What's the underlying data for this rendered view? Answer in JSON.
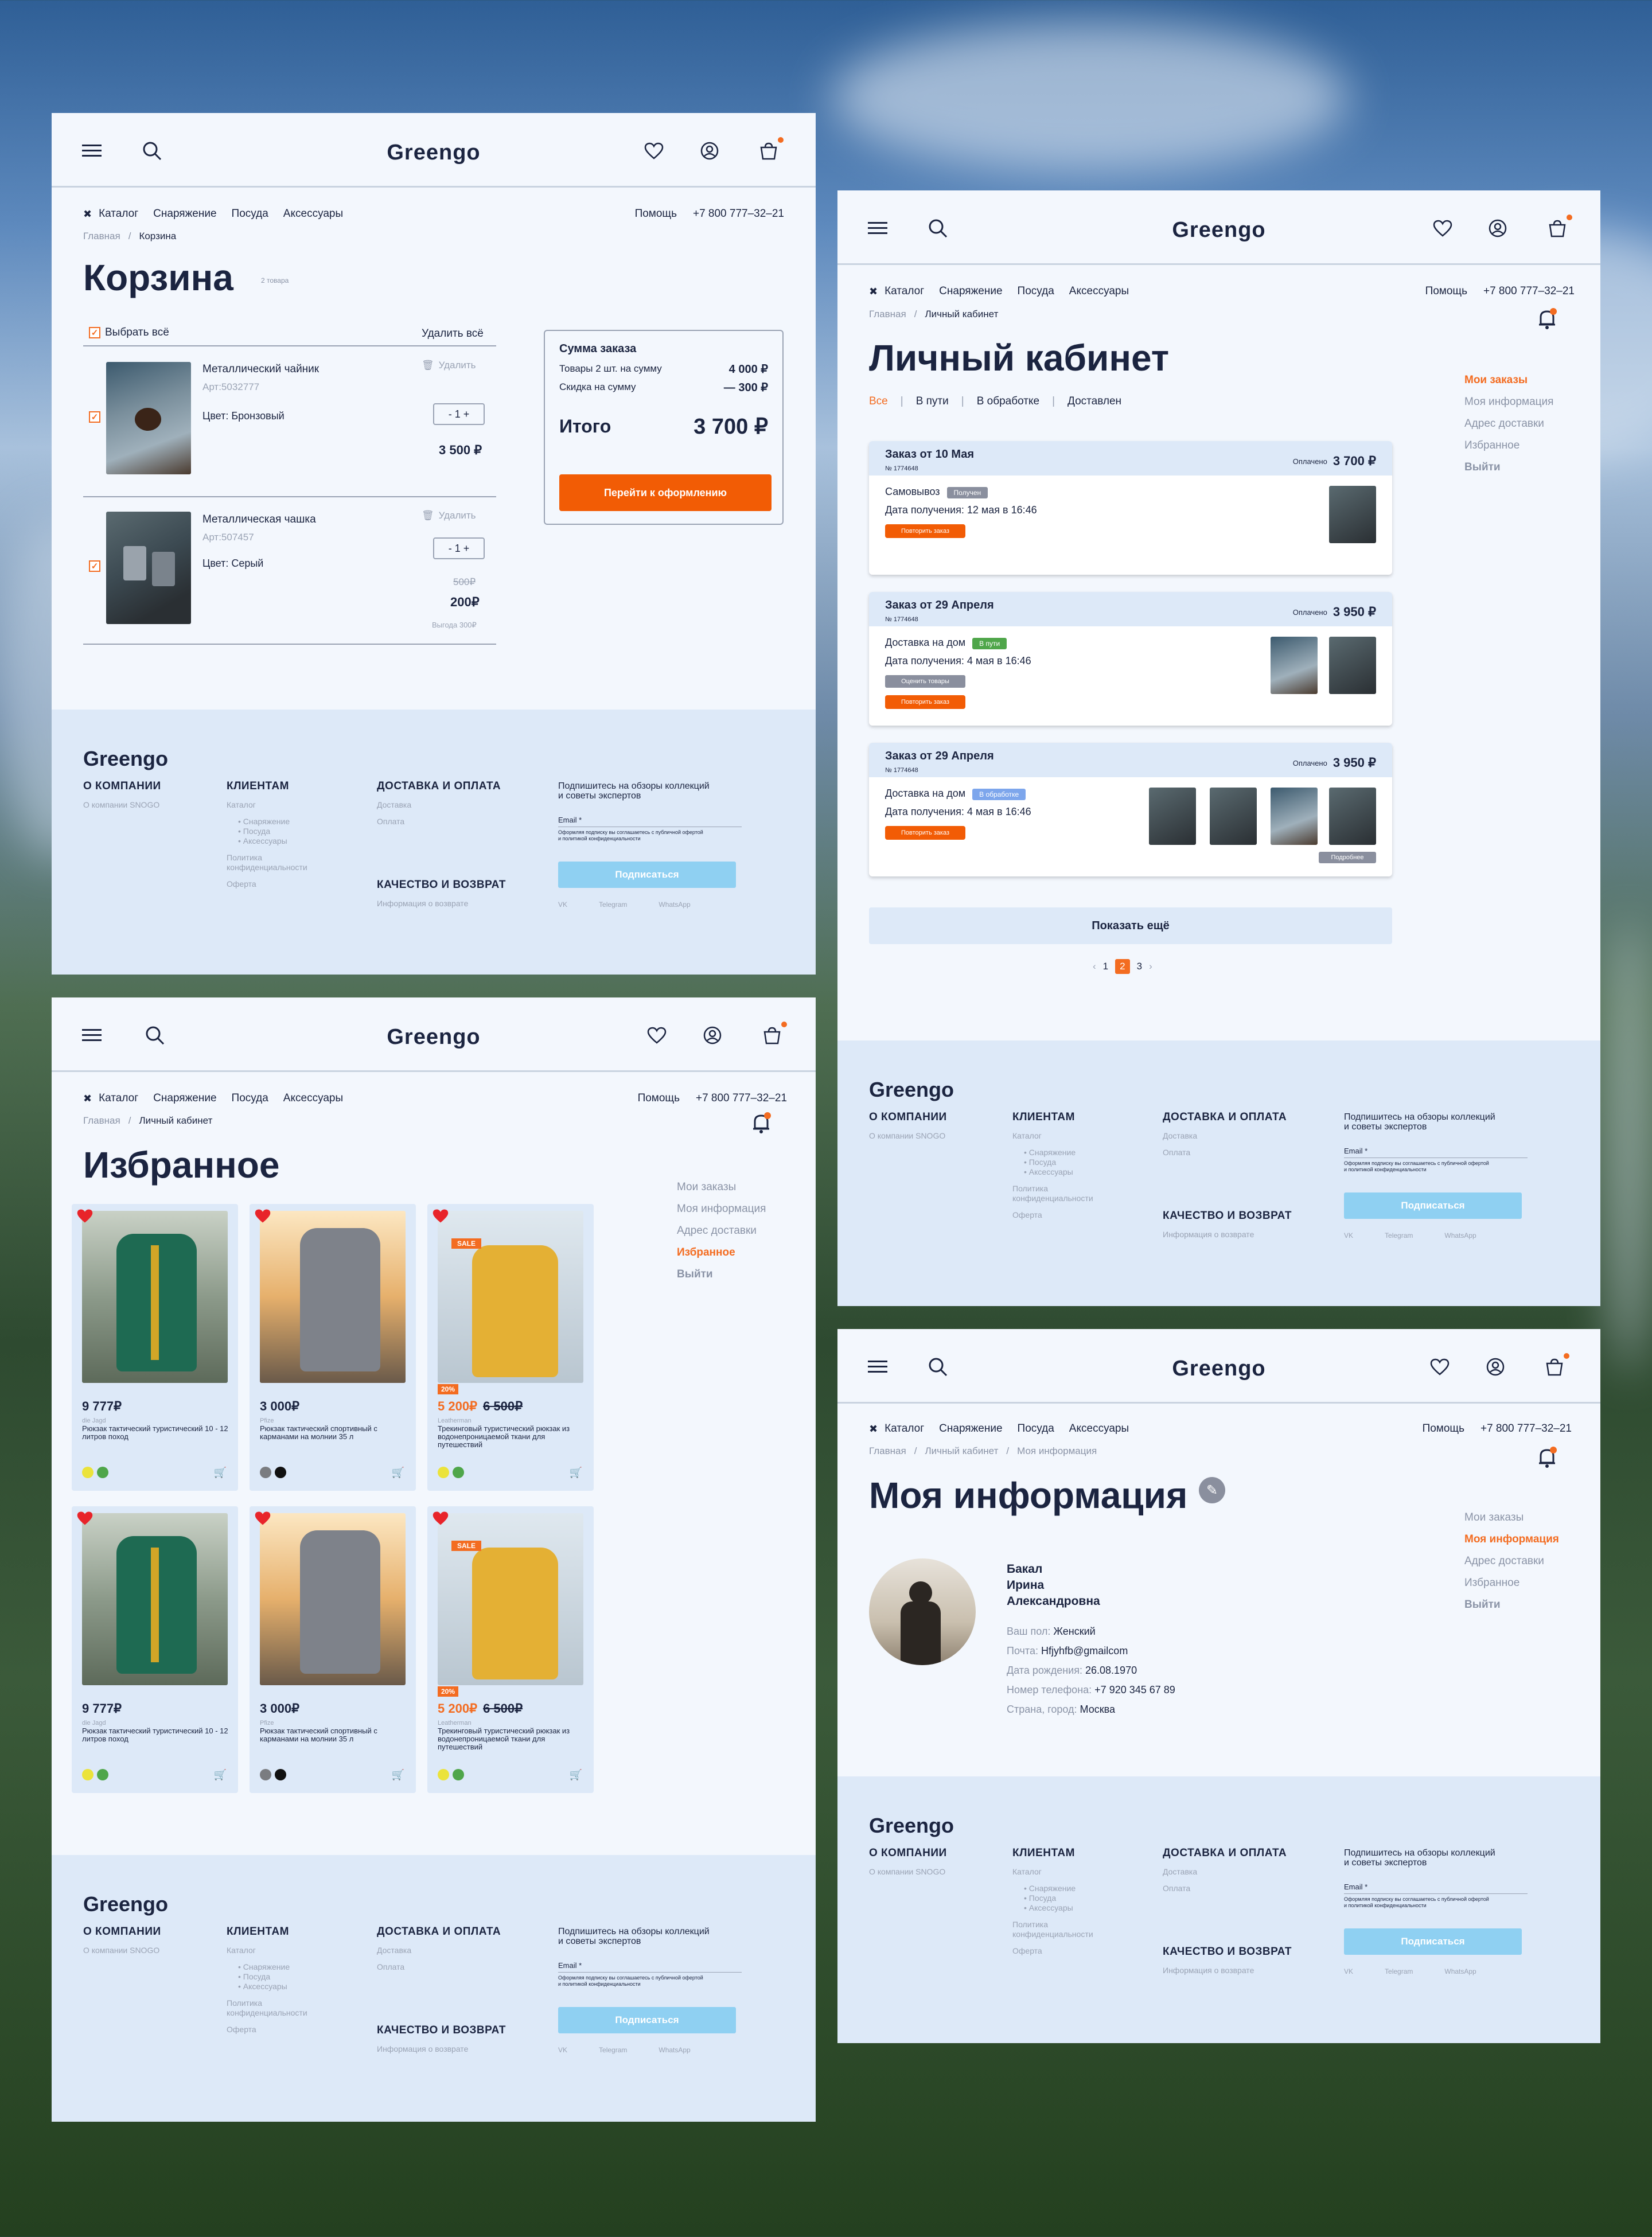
{
  "brand": "Greengo",
  "nav": {
    "catalog": "Каталог",
    "equipment": "Снаряжение",
    "dishes": "Посуда",
    "accessories": "Аксессуары",
    "help": "Помощь",
    "phone": "+7 800 777–32–21"
  },
  "crumbs": {
    "home": "Главная",
    "sep": "/",
    "cart": "Корзина",
    "account": "Личный кабинет",
    "myinfo": "Моя информация"
  },
  "cart": {
    "title": "Корзина",
    "count": "2 товара",
    "select_all": "Выбрать всё",
    "delete_all": "Удалить всё",
    "delete": "Удалить",
    "items": [
      {
        "name": "Металлический чайник",
        "art": "Арт:5032777",
        "color": "Цвет: Бронзовый",
        "qty": "- 1 +",
        "price": "3 500 ₽"
      },
      {
        "name": "Металлическая чашка",
        "art": "Арт:507457",
        "color": "Цвет: Серый",
        "qty": "- 1 +",
        "old": "500₽",
        "price": "200₽",
        "saving": "Выгода 300₽"
      }
    ],
    "summary": {
      "title": "Сумма заказа",
      "goods": "Товары 2 шт. на сумму",
      "goods_val": "4 000 ₽",
      "discount": "Скидка на сумму",
      "discount_val": "— 300 ₽",
      "total": "Итого",
      "total_val": "3 700 ₽",
      "button": "Перейти к оформлению"
    }
  },
  "account": {
    "title": "Личный кабинет",
    "tabs": [
      "Все",
      "В пути",
      "В обработке",
      "Доставлен"
    ],
    "paid": "Оплачено",
    "get": "Дата получения:",
    "repeat": "Повторить заказ",
    "rate": "Оценить товары",
    "details": "Подробнее",
    "orders": [
      {
        "title": "Заказ от 10 Мая",
        "num": "№ 1774648",
        "sum": "3 700 ₽",
        "method": "Самовывоз",
        "status": "Получен",
        "date": "12 мая в 16:46"
      },
      {
        "title": "Заказ от 29 Апреля",
        "num": "№ 1774648",
        "sum": "3 950 ₽",
        "method": "Доставка на дом",
        "status": "В пути",
        "date": "4 мая в 16:46"
      },
      {
        "title": "Заказ от 29 Апреля",
        "num": "№ 1774648",
        "sum": "3 950 ₽",
        "method": "Доставка на дом",
        "status": "В обработке",
        "date": "4 мая в 16:46"
      }
    ],
    "show_more": "Показать ещё",
    "pages": [
      "1",
      "2",
      "3"
    ],
    "prev": "‹",
    "next": "›"
  },
  "menu": {
    "orders": "Мои заказы",
    "info": "Моя информация",
    "address": "Адрес доставки",
    "fav": "Избранное",
    "exit": "Выйти"
  },
  "favorites": {
    "title": "Избранное",
    "sale": "SALE",
    "disc": "20%",
    "items": [
      {
        "price": "9 777₽",
        "brand": "die Jagd",
        "desc": "Рюкзак тактический туристический 10 - 12 литров поход"
      },
      {
        "price": "3 000₽",
        "brand": "Pfize",
        "desc": "Рюкзак тактический спортивный с карманами на молнии 35 л"
      },
      {
        "price": "5 200₽",
        "old": "6 500₽",
        "brand": "Leatherman",
        "desc": "Трекинговый туристический рюкзак из водонепроницаемой ткани для путешествий"
      }
    ]
  },
  "profile": {
    "title": "Моя информация",
    "surname": "Бакал",
    "name": "Ирина",
    "patronymic": "Александровна",
    "fields": [
      {
        "k": "Ваш пол:",
        "v": "Женский"
      },
      {
        "k": "Почта:",
        "v": "Hfjyhfb@gmailcom"
      },
      {
        "k": "Дата рождения:",
        "v": "26.08.1970"
      },
      {
        "k": "Номер телефона:",
        "v": "+7 920 345 67 89"
      },
      {
        "k": "Страна, город:",
        "v": "Москва"
      }
    ]
  },
  "footer": {
    "about": "О КОМПАНИИ",
    "about_link": "О компании SNOGO",
    "clients": "КЛИЕНТАМ",
    "catalog": "Каталог",
    "sub1": "• Снаряжение",
    "sub2": "• Посуда",
    "sub3": "• Аксессуары",
    "policy1": "Политика",
    "policy2": "конфиденциальности",
    "offer": "Оферта",
    "delivery": "ДОСТАВКА И ОПЛАТА",
    "delivery_link": "Доставка",
    "payment": "Оплата",
    "quality": "КАЧЕСТВО И ВОЗВРАТ",
    "return_info": "Информация о возврате",
    "subscribe1": "Подпишитесь на обзоры коллекций",
    "subscribe2": "и советы экспертов",
    "email": "Email *",
    "consent1": "Оформляя подписку вы соглашаетесь с публичной офертой",
    "consent2": "и политикой конфиденциальности",
    "sub_btn": "Подписаться",
    "vk": "VK",
    "tg": "Telegram",
    "wa": "WhatsApp"
  }
}
